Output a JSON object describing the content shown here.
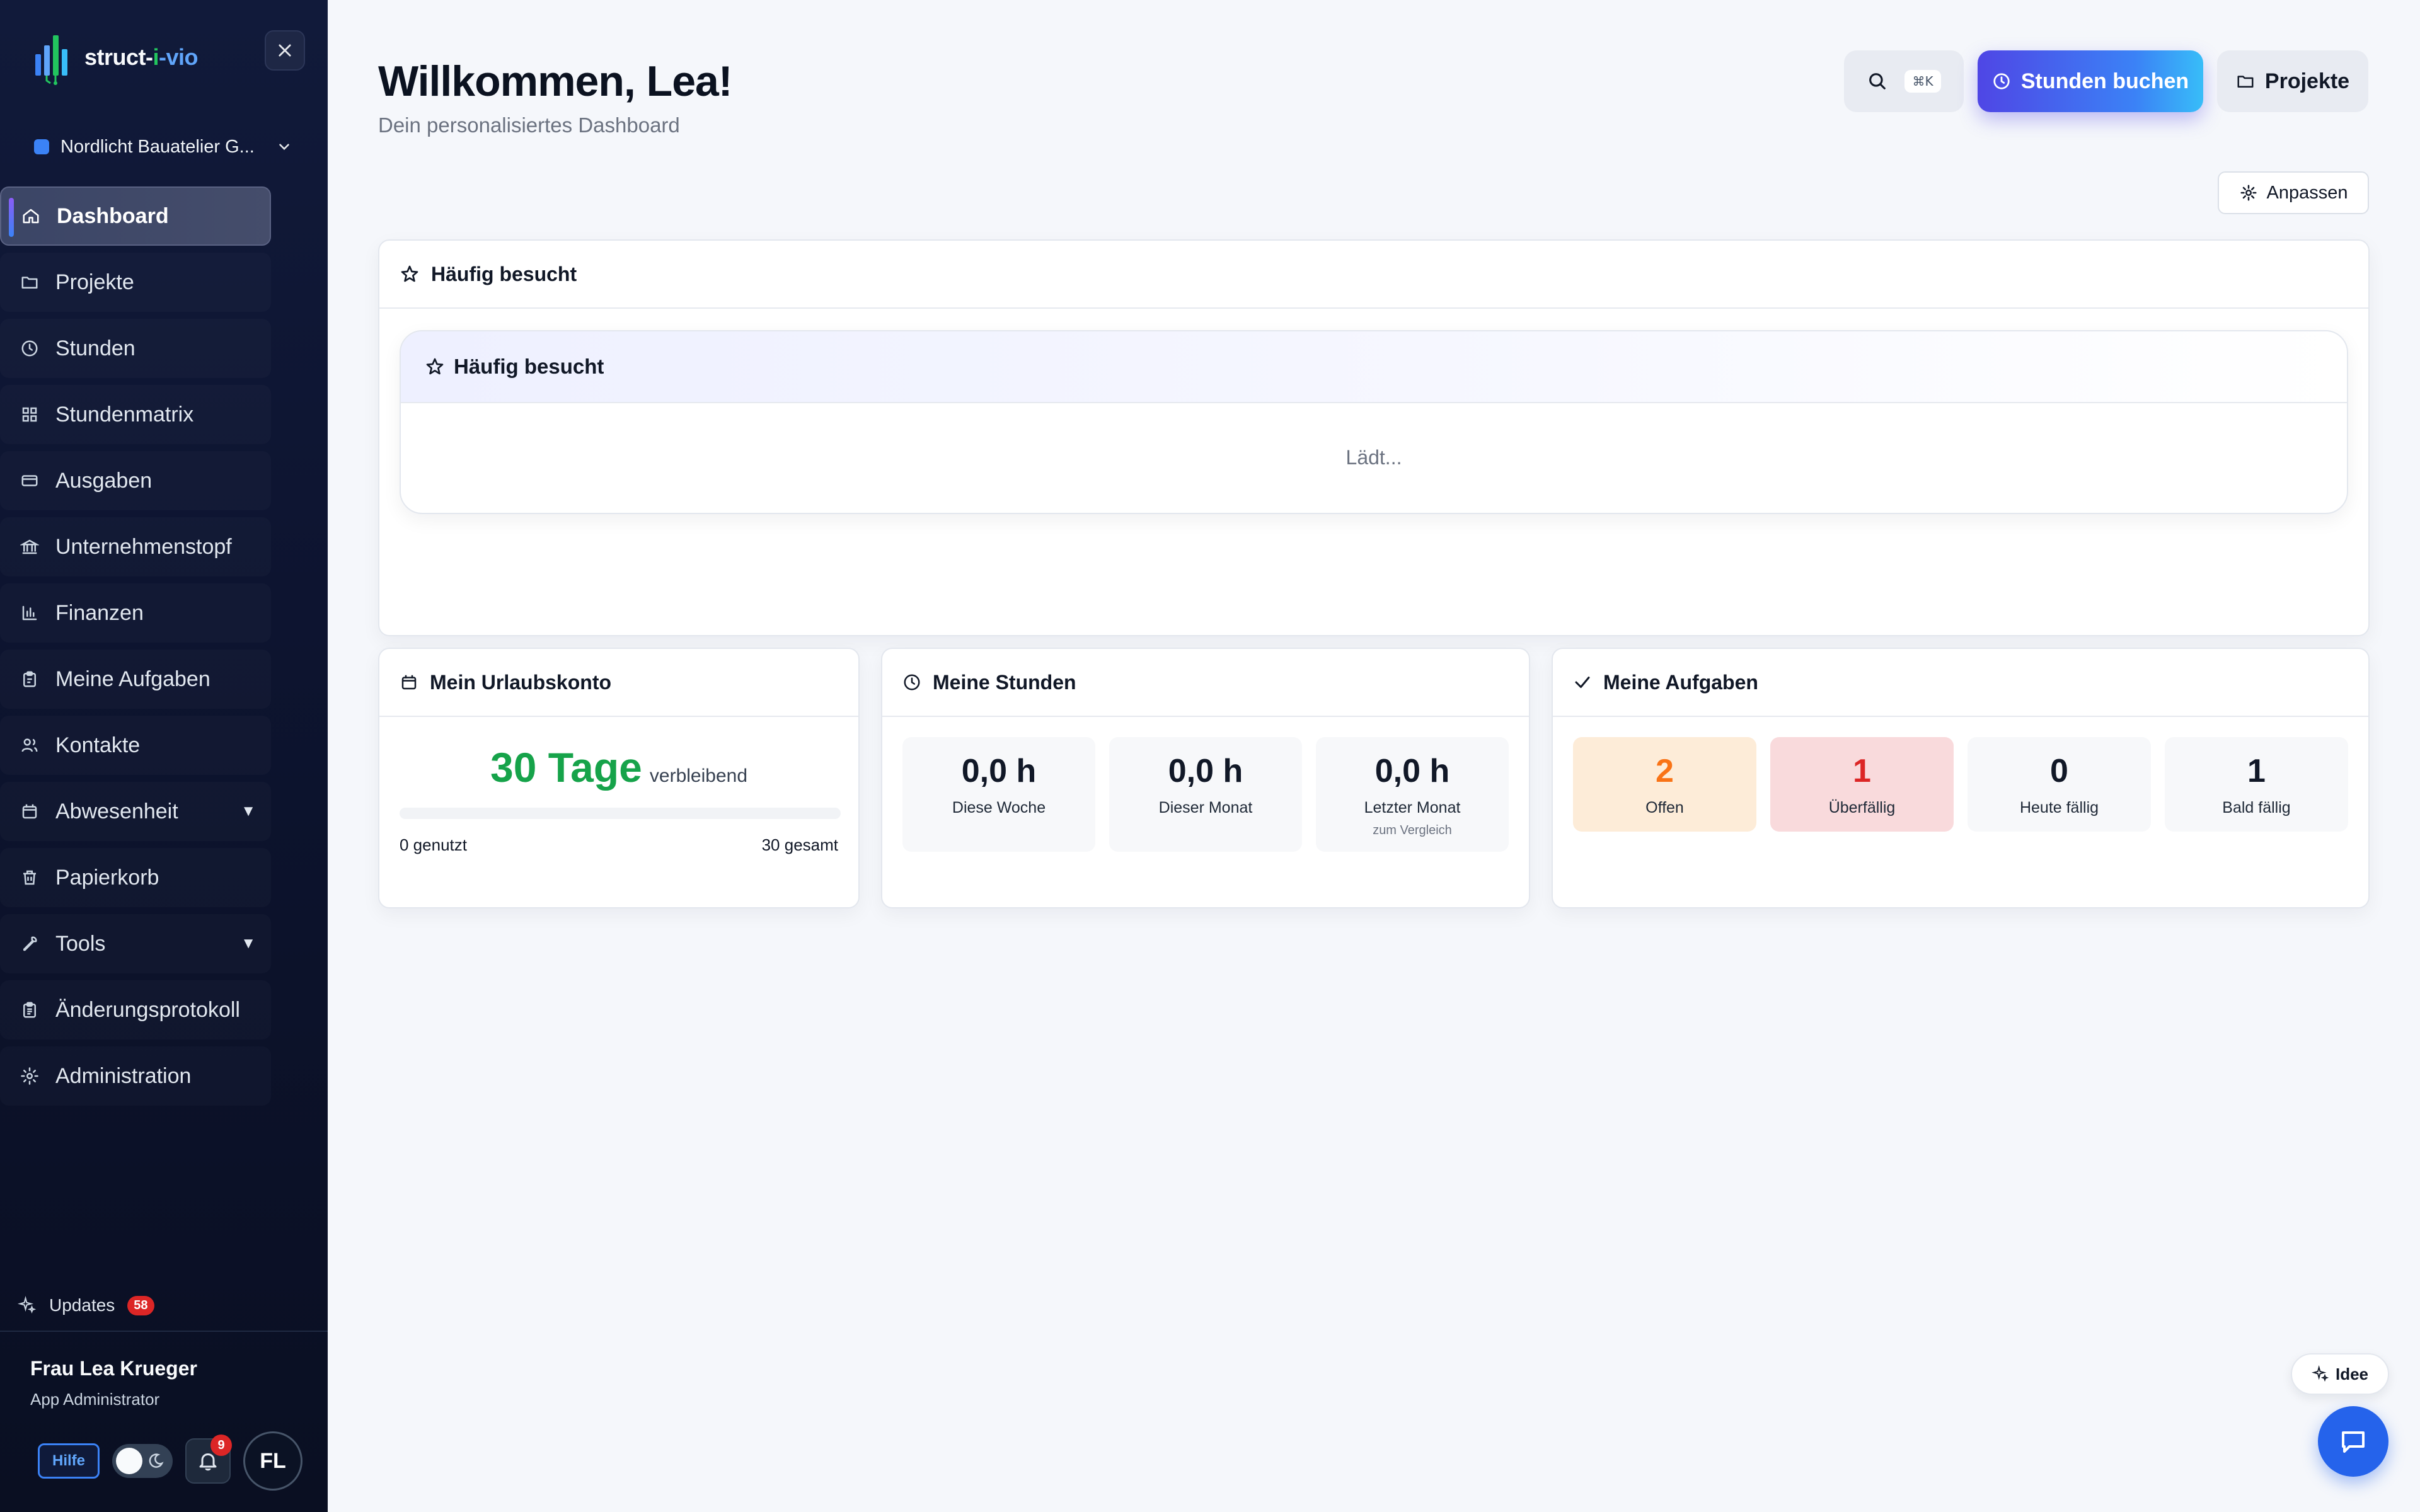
{
  "sidebar": {
    "logo": {
      "part1": "struct-",
      "part2": "i",
      "part3": "-vio"
    },
    "org_name": "Nordlicht Bauatelier G...",
    "nav": [
      {
        "label": "Dashboard",
        "icon": "home-icon",
        "active": true
      },
      {
        "label": "Projekte",
        "icon": "folder-icon"
      },
      {
        "label": "Stunden",
        "icon": "clock-icon"
      },
      {
        "label": "Stundenmatrix",
        "icon": "grid-icon"
      },
      {
        "label": "Ausgaben",
        "icon": "credit-card-icon"
      },
      {
        "label": "Unternehmenstopf",
        "icon": "bank-icon"
      },
      {
        "label": "Finanzen",
        "icon": "bar-chart-icon"
      },
      {
        "label": "Meine Aufgaben",
        "icon": "clipboard-icon"
      },
      {
        "label": "Kontakte",
        "icon": "users-icon"
      },
      {
        "label": "Abwesenheit",
        "icon": "calendar-icon",
        "expandable": true
      },
      {
        "label": "Papierkorb",
        "icon": "trash-icon"
      },
      {
        "label": "Tools",
        "icon": "wrench-icon",
        "expandable": true
      },
      {
        "label": "Änderungsprotokoll",
        "icon": "clipboard-list-icon"
      },
      {
        "label": "Administration",
        "icon": "gear-icon"
      }
    ],
    "updates_label": "Updates",
    "updates_count": "58",
    "user_name": "Frau Lea Krueger",
    "user_role": "App Administrator",
    "help_label": "Hilfe",
    "notification_count": "9",
    "avatar_initials": "FL"
  },
  "header": {
    "title": "Willkommen, Lea!",
    "subtitle": "Dein personalisiertes Dashboard",
    "search_shortcut": "⌘K",
    "book_hours_label": "Stunden buchen",
    "projects_label": "Projekte",
    "customize_label": "Anpassen"
  },
  "frequent": {
    "title": "Häufig besucht",
    "inner_title": "Häufig besucht",
    "loading": "Lädt..."
  },
  "vacation": {
    "title": "Mein Urlaubskonto",
    "remaining": "30 Tage",
    "remaining_label": "verbleibend",
    "used_fraction": 0,
    "used": "0 genutzt",
    "total": "30 gesamt"
  },
  "hours": {
    "title": "Meine Stunden",
    "stats": [
      {
        "value": "0,0 h",
        "label": "Diese Woche"
      },
      {
        "value": "0,0 h",
        "label": "Dieser Monat"
      },
      {
        "value": "0,0 h",
        "label": "Letzter Monat",
        "note": "zum Vergleich"
      }
    ]
  },
  "tasks": {
    "title": "Meine Aufgaben",
    "stats": [
      {
        "value": "2",
        "label": "Offen"
      },
      {
        "value": "1",
        "label": "Überfällig"
      },
      {
        "value": "0",
        "label": "Heute fällig"
      },
      {
        "value": "1",
        "label": "Bald fällig"
      }
    ]
  },
  "floating": {
    "idea_label": "Idee"
  },
  "colors": {
    "accent": "#4f46e5",
    "success": "#16a34a",
    "danger": "#dc2626",
    "warning": "#f97316"
  }
}
